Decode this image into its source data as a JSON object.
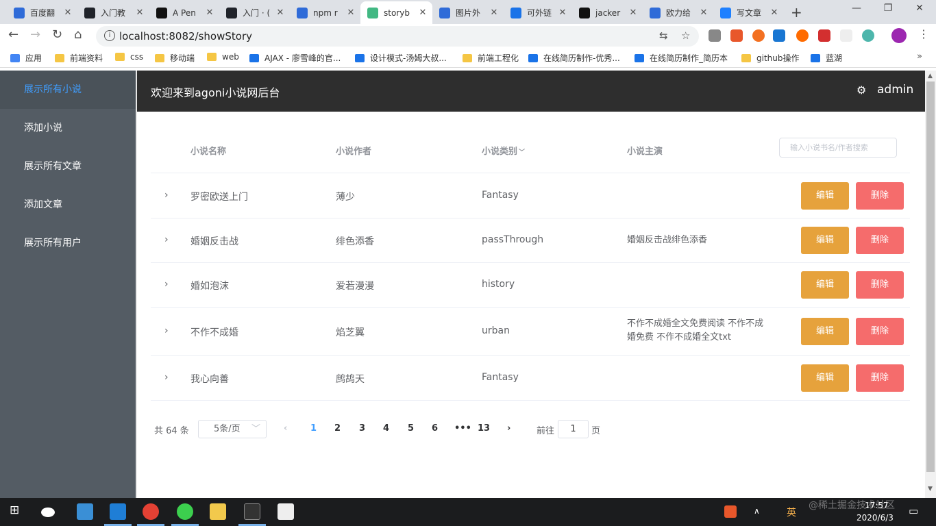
{
  "browser": {
    "tabs": [
      {
        "title": "百度翻",
        "icon": "baidu-translate-icon",
        "color": "#2f6bd8"
      },
      {
        "title": "入门教",
        "icon": "react-icon",
        "color": "#20232a"
      },
      {
        "title": "A Pen",
        "icon": "codepen-icon",
        "color": "#111111"
      },
      {
        "title": "入门 · (",
        "icon": "react-icon",
        "color": "#20232a"
      },
      {
        "title": "npm r",
        "icon": "baidu-paw-icon",
        "color": "#2f6bd8"
      },
      {
        "title": "storyb",
        "icon": "vue-icon",
        "color": "#42b883"
      },
      {
        "title": "图片外",
        "icon": "baidu-paw-icon",
        "color": "#2f6bd8"
      },
      {
        "title": "可外链",
        "icon": "loading-icon",
        "color": "#1a73e8"
      },
      {
        "title": "jacker",
        "icon": "github-icon",
        "color": "#111111"
      },
      {
        "title": "欧力给",
        "icon": "baidu-paw-icon",
        "color": "#2f6bd8"
      },
      {
        "title": "写文章",
        "icon": "juejin-icon",
        "color": "#1e80ff"
      }
    ],
    "url": "localhost:8082/showStory",
    "bookmarks": [
      {
        "label": "应用",
        "type": "apps"
      },
      {
        "label": "前端资料",
        "type": "folder"
      },
      {
        "label": "css",
        "type": "folder"
      },
      {
        "label": "移动端",
        "type": "folder"
      },
      {
        "label": "web",
        "type": "folder"
      },
      {
        "label": "AJAX - 廖雪峰的官...",
        "type": "link"
      },
      {
        "label": "设计模式-汤姆大叔...",
        "type": "link"
      },
      {
        "label": "前端工程化",
        "type": "folder"
      },
      {
        "label": "在线简历制作-优秀...",
        "type": "link"
      },
      {
        "label": "在线简历制作_简历本",
        "type": "link"
      },
      {
        "label": "github操作",
        "type": "folder"
      },
      {
        "label": "蓝湖",
        "type": "link"
      }
    ]
  },
  "sidebar": {
    "items": [
      {
        "label": "展示所有小说",
        "active": true
      },
      {
        "label": "添加小说",
        "active": false
      },
      {
        "label": "展示所有文章",
        "active": false
      },
      {
        "label": "添加文章",
        "active": false
      },
      {
        "label": "展示所有用户",
        "active": false
      }
    ]
  },
  "header": {
    "title": "欢迎来到agoni小说网后台",
    "user": "admin"
  },
  "table": {
    "columns": {
      "name": "小说名称",
      "author": "小说作者",
      "category": "小说类别",
      "lead": "小说主演"
    },
    "search_placeholder": "输入小说书名/作者搜索",
    "rows": [
      {
        "name": "罗密欧送上门",
        "author": "薄少",
        "category": "Fantasy",
        "lead": ""
      },
      {
        "name": "婚姻反击战",
        "author": "绯色添香",
        "category": "passThrough",
        "lead": "婚姻反击战绯色添香"
      },
      {
        "name": "婚如泡沫",
        "author": "爱若漫漫",
        "category": "history",
        "lead": ""
      },
      {
        "name": "不作不成婚",
        "author": "焰芝翼",
        "category": "urban",
        "lead": "不作不成婚全文免费阅读 不作不成婚免费 不作不成婚全文txt"
      },
      {
        "name": "我心向善",
        "author": "鹧鸪天",
        "category": "Fantasy",
        "lead": ""
      }
    ],
    "edit_label": "编辑",
    "delete_label": "删除"
  },
  "pagination": {
    "total_text": "共 64 条",
    "page_size": "5条/页",
    "pages": [
      "1",
      "2",
      "3",
      "4",
      "5",
      "6",
      "•••",
      "13"
    ],
    "current": "1",
    "goto_label": "前往",
    "goto_value": "1",
    "page_suffix": "页"
  },
  "taskbar": {
    "time": "17:57",
    "date": "2020/6/3",
    "ime": "英",
    "watermark": "@稀土掘金技术社区"
  },
  "colors": {
    "accent": "#409eff",
    "sidebar_bg": "#545c64",
    "header_bg": "#2e2e2e",
    "edit": "#e6a23c",
    "delete": "#f56c6c"
  }
}
